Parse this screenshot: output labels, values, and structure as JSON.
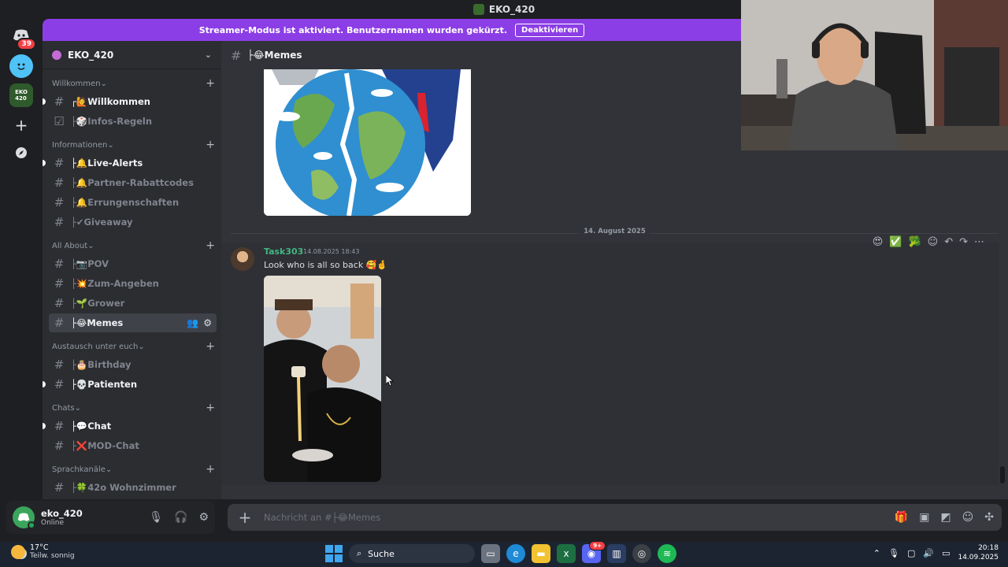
{
  "window": {
    "title": "EKO_420"
  },
  "rail": {
    "notif_badge": "39"
  },
  "banner": {
    "text": "Streamer-Modus ist aktiviert. Benutzernamen wurden gekürzt.",
    "button": "Deaktivieren"
  },
  "server": {
    "name": "EKO_420"
  },
  "categories": [
    {
      "name": "Willkommen",
      "channels": [
        {
          "label": "┌🙋Willkommen",
          "state": "unread"
        },
        {
          "label": "├🎲Infos-Regeln",
          "state": "read",
          "icon": "check-icon"
        }
      ]
    },
    {
      "name": "Informationen",
      "channels": [
        {
          "label": "├🔔Live-Alerts",
          "state": "unread"
        },
        {
          "label": "├🔔Partner-Rabattcodes",
          "state": "read"
        },
        {
          "label": "├🔔Errungenschaften",
          "state": "read"
        },
        {
          "label": "├✔Giveaway",
          "state": "read"
        }
      ]
    },
    {
      "name": "All About",
      "channels": [
        {
          "label": "├📷POV",
          "state": "read"
        },
        {
          "label": "├💥Zum-Angeben",
          "state": "read"
        },
        {
          "label": "├🌱Grower",
          "state": "read"
        },
        {
          "label": "├😂Memes",
          "state": "active"
        }
      ]
    },
    {
      "name": "Austausch unter euch",
      "channels": [
        {
          "label": "├🎂Birthday",
          "state": "read"
        },
        {
          "label": "├💀Patienten",
          "state": "unread"
        }
      ]
    },
    {
      "name": "Chats",
      "channels": [
        {
          "label": "├💬Chat",
          "state": "unread"
        },
        {
          "label": "├❌MOD-Chat",
          "state": "read"
        }
      ]
    },
    {
      "name": "Sprachkanäle",
      "channels": [
        {
          "label": "├🍀42o Wohnzimmer",
          "state": "read"
        }
      ]
    }
  ],
  "user": {
    "name": "eko_420",
    "status": "Online"
  },
  "channel_header": {
    "name": "├😂Memes"
  },
  "date_divider": "14. August 2025",
  "message": {
    "author": "Task303",
    "timestamp": "14.08.2025 18:43",
    "text": "Look who is all so back 🥰🤞",
    "reactions": [
      "😍",
      "✅",
      "🥦"
    ]
  },
  "composer": {
    "placeholder": "Nachricht an #├😂Memes"
  },
  "taskbar": {
    "temperature": "17°C",
    "weather": "Teilw. sonnig",
    "search": "Suche",
    "discord_badge": "9+",
    "time": "20:18",
    "date": "14.09.2025"
  },
  "colors": {
    "accent": "#8c3ee6",
    "author": "#43b581",
    "sidebar": "#2b2d31",
    "main": "#313338"
  }
}
